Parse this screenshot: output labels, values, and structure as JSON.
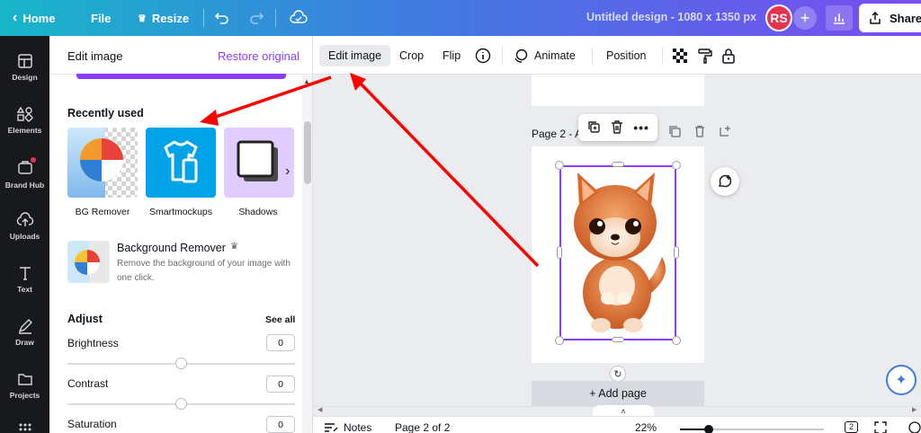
{
  "topbar": {
    "home_label": "Home",
    "file_label": "File",
    "resize_label": "Resize",
    "design_title": "Untitled design - 1080 x 1350 px",
    "avatar_initials": "RS",
    "share_label": "Share"
  },
  "rail": {
    "items": [
      {
        "label": "Design",
        "icon": "layout-icon"
      },
      {
        "label": "Elements",
        "icon": "shapes-icon"
      },
      {
        "label": "Brand Hub",
        "icon": "brand-hub-icon"
      },
      {
        "label": "Uploads",
        "icon": "cloud-upload-icon"
      },
      {
        "label": "Text",
        "icon": "text-icon"
      },
      {
        "label": "Draw",
        "icon": "pen-icon"
      },
      {
        "label": "Projects",
        "icon": "folder-icon"
      }
    ]
  },
  "panel": {
    "title": "Edit image",
    "restore_label": "Restore original",
    "recently_used_title": "Recently used",
    "tiles": [
      {
        "label": "BG Remover"
      },
      {
        "label": "Smartmockups"
      },
      {
        "label": "Shadows"
      }
    ],
    "bg_remover": {
      "title": "Background Remover",
      "description": "Remove the background of your image with one click."
    },
    "adjust": {
      "title": "Adjust",
      "see_all": "See all",
      "items": [
        {
          "label": "Brightness",
          "value": "0"
        },
        {
          "label": "Contrast",
          "value": "0"
        },
        {
          "label": "Saturation",
          "value": "0"
        }
      ]
    }
  },
  "toolbar": {
    "edit_image": "Edit image",
    "crop": "Crop",
    "flip": "Flip",
    "animate": "Animate",
    "position": "Position"
  },
  "canvas": {
    "page2_label": "Page 2 - A",
    "add_page": "+ Add page"
  },
  "bottombar": {
    "notes": "Notes",
    "page_indicator": "Page 2 of 2",
    "zoom": "22%",
    "page_count_badge": "2"
  },
  "colors": {
    "accent": "#8b3dff",
    "annotation_arrow": "#ff0000",
    "avatar_bg": "#e5344f",
    "tile_smartmockups_bg": "#00a2e8",
    "tile_shadows_bg": "#e0ccff"
  }
}
